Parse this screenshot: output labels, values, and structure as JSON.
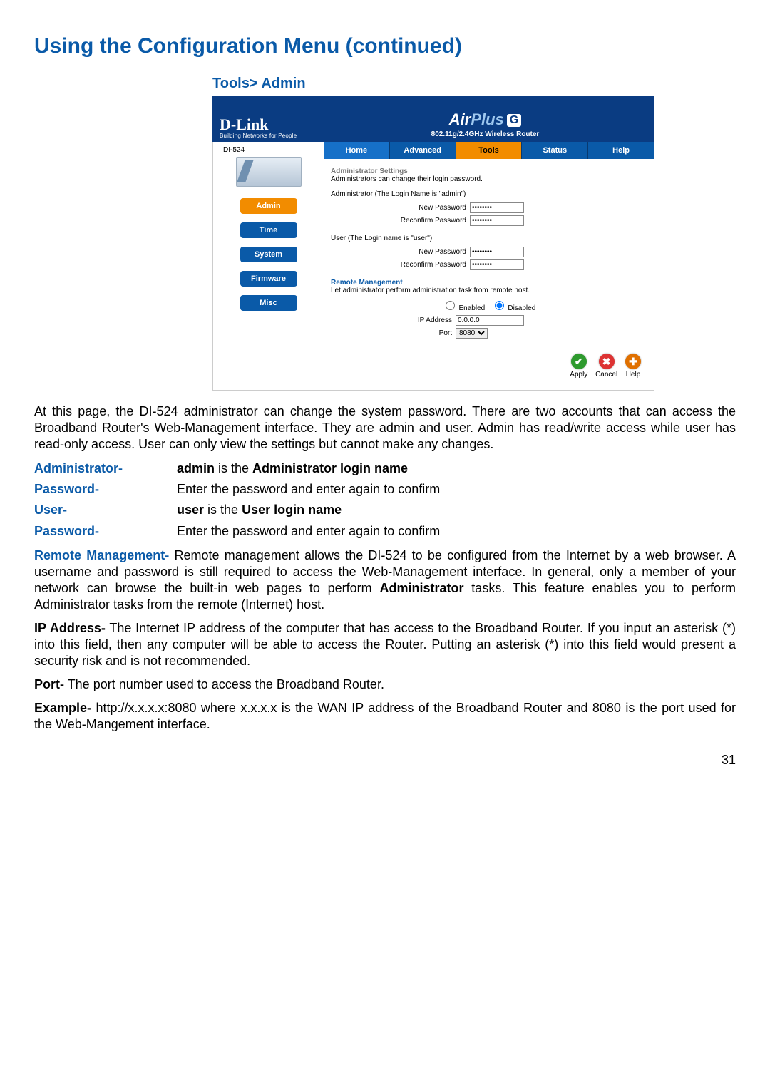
{
  "page_title": "Using the Configuration Menu (continued)",
  "breadcrumb": "Tools> Admin",
  "router": {
    "logo_text": "D-Link",
    "logo_tagline": "Building Networks for People",
    "brand_air": "Air",
    "brand_plus": "Plus",
    "brand_g": "G",
    "brand_sub": "802.11g/2.4GHz Wireless Router",
    "model": "DI-524",
    "sidebar": [
      {
        "label": "Admin",
        "active": true
      },
      {
        "label": "Time",
        "active": false
      },
      {
        "label": "System",
        "active": false
      },
      {
        "label": "Firmware",
        "active": false
      },
      {
        "label": "Misc",
        "active": false
      }
    ],
    "tabs": [
      {
        "label": "Home",
        "cls": "home"
      },
      {
        "label": "Advanced",
        "cls": ""
      },
      {
        "label": "Tools",
        "cls": "selected"
      },
      {
        "label": "Status",
        "cls": ""
      },
      {
        "label": "Help",
        "cls": ""
      }
    ],
    "admin_settings_head": "Administrator Settings",
    "admin_settings_sub": "Administrators can change their login password.",
    "admin_section": "Administrator (The Login Name is \"admin\")",
    "user_section": "User (The Login name is \"user\")",
    "new_pw_label": "New  Password",
    "reconfirm_label": "Reconfirm  Password",
    "pw_mask": "••••••••",
    "remote_head": "Remote Management",
    "remote_sub": "Let administrator perform administration task from remote host.",
    "enabled": "Enabled",
    "disabled": "Disabled",
    "ip_label": "IP Address",
    "ip_value": "0.0.0.0",
    "port_label": "Port",
    "port_value": "8080",
    "actions": {
      "apply": "Apply",
      "cancel": "Cancel",
      "help": "Help"
    }
  },
  "doc": {
    "intro": "At this page, the DI-524 administrator can change the system password. There are two accounts that can access the Broadband Router's Web-Management interface. They are admin and user. Admin has read/write access while user has read-only access. User can only view the settings but cannot make any changes.",
    "defs": [
      {
        "term": "Administrator-",
        "def_pre": "admin",
        "def_mid": " is the ",
        "def_bold": "Administrator login name",
        "def_post": ""
      },
      {
        "term": "Password-",
        "def_plain": "Enter the password and enter again to confirm"
      },
      {
        "term": "User-",
        "def_pre": "user",
        "def_mid": " is the ",
        "def_bold": "User login name",
        "def_post": ""
      },
      {
        "term": "Password-",
        "def_plain": "Enter the password and enter again to confirm"
      }
    ],
    "remote_label": "Remote Management-",
    "remote_text": " Remote management allows the DI-524 to be configured from the Internet by a web browser. A username and password is still required to access the Web-Management interface. In general, only a member of your network can browse the built-in web pages to perform ",
    "remote_bold": "Administrator",
    "remote_text2": " tasks. This feature enables you to perform Administrator tasks from the remote (Internet) host.",
    "ip_label": "IP Address-",
    "ip_text": " The Internet IP address of the computer that has access to the Broadband Router. If you input an asterisk (*) into this field, then any computer will be able to access the Router. Putting an asterisk (*) into this field would present a security risk and is not recommended.",
    "port_label": "Port-",
    "port_text": " The port number used to access the Broadband Router.",
    "example_label": "Example-",
    "example_text": " http://x.x.x.x:8080 where x.x.x.x is the WAN IP address of the Broadband Router and 8080 is the port used for the Web-Mangement interface.",
    "page_number": "31"
  }
}
